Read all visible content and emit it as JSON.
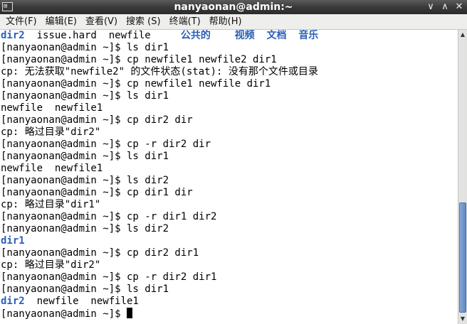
{
  "window": {
    "title": "nanyaonan@admin:~",
    "title_icon": "⊠",
    "buttons": {
      "minimize": "∨",
      "maximize": "∧",
      "close": "✕"
    }
  },
  "menu": {
    "items": [
      "文件(F)",
      "编辑(E)",
      "查看(V)",
      "搜索 (S)",
      "终端(T)",
      "帮助(H)"
    ]
  },
  "terminal": {
    "lines": [
      [
        {
          "t": "dir2",
          "c": "dir"
        },
        {
          "t": "  issue.hard  newfile     "
        },
        {
          "t": "公共的",
          "c": "dir"
        },
        {
          "t": "    "
        },
        {
          "t": "视频",
          "c": "dir"
        },
        {
          "t": "  "
        },
        {
          "t": "文档",
          "c": "dir"
        },
        {
          "t": "  "
        },
        {
          "t": "音乐",
          "c": "dir"
        }
      ],
      [
        {
          "t": "[nanyaonan@admin ~]$ ls dir1"
        }
      ],
      [
        {
          "t": "[nanyaonan@admin ~]$ cp newfile1 newfile2 dir1"
        }
      ],
      [
        {
          "t": "cp: 无法获取\"newfile2\" 的文件状态(stat): 没有那个文件或目录"
        }
      ],
      [
        {
          "t": "[nanyaonan@admin ~]$ cp newfile1 newfile dir1"
        }
      ],
      [
        {
          "t": "[nanyaonan@admin ~]$ ls dir1"
        }
      ],
      [
        {
          "t": "newfile  newfile1"
        }
      ],
      [
        {
          "t": "[nanyaonan@admin ~]$ cp dir2 dir"
        }
      ],
      [
        {
          "t": "cp: 略过目录\"dir2\""
        }
      ],
      [
        {
          "t": "[nanyaonan@admin ~]$ cp -r dir2 dir"
        }
      ],
      [
        {
          "t": "[nanyaonan@admin ~]$ ls dir1"
        }
      ],
      [
        {
          "t": "newfile  newfile1"
        }
      ],
      [
        {
          "t": "[nanyaonan@admin ~]$ ls dir2"
        }
      ],
      [
        {
          "t": "[nanyaonan@admin ~]$ cp dir1 dir"
        }
      ],
      [
        {
          "t": "cp: 略过目录\"dir1\""
        }
      ],
      [
        {
          "t": "[nanyaonan@admin ~]$ cp -r dir1 dir2"
        }
      ],
      [
        {
          "t": "[nanyaonan@admin ~]$ ls dir2"
        }
      ],
      [
        {
          "t": "dir1",
          "c": "dir"
        }
      ],
      [
        {
          "t": "[nanyaonan@admin ~]$ cp dir2 dir1"
        }
      ],
      [
        {
          "t": "cp: 略过目录\"dir2\""
        }
      ],
      [
        {
          "t": "[nanyaonan@admin ~]$ cp -r dir2 dir1"
        }
      ],
      [
        {
          "t": "[nanyaonan@admin ~]$ ls dir1"
        }
      ],
      [
        {
          "t": "dir2",
          "c": "dir"
        },
        {
          "t": "  newfile  newfile1"
        }
      ],
      [
        {
          "t": "[nanyaonan@admin ~]$ "
        },
        {
          "cursor": true
        }
      ]
    ]
  },
  "scrollbar": {
    "up_arrow": "▲",
    "down_arrow": "▼"
  },
  "colors": {
    "directory": "#2a5fb8",
    "text": "#000000",
    "background": "#ffffff"
  }
}
